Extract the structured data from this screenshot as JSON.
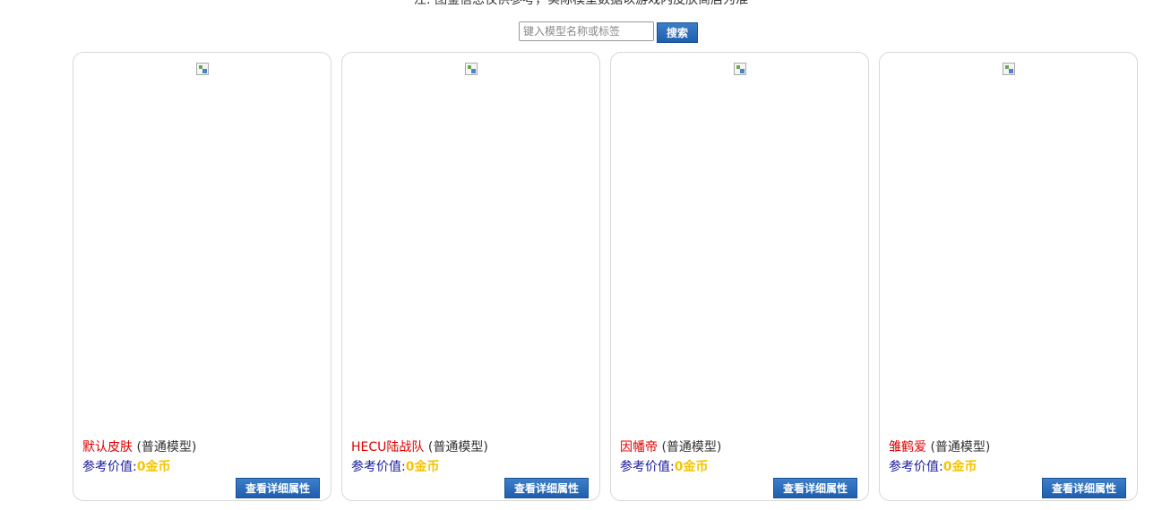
{
  "notice": "注: 图鉴信息仅供参考，实际模型数据以游戏内皮肤商店为准",
  "search": {
    "placeholder": "键入模型名称或标签",
    "button_label": "搜索"
  },
  "cards": [
    {
      "name": "默认皮肤",
      "type": "(普通模型)",
      "price_label": "参考价值:",
      "price_value": "0金币",
      "detail_label": "查看详细属性"
    },
    {
      "name": "HECU陆战队",
      "type": "(普通模型)",
      "price_label": "参考价值:",
      "price_value": "0金币",
      "detail_label": "查看详细属性"
    },
    {
      "name": "因幡帝",
      "type": "(普通模型)",
      "price_label": "参考价值:",
      "price_value": "0金币",
      "detail_label": "查看详细属性"
    },
    {
      "name": "雏鹤爱",
      "type": "(普通模型)",
      "price_label": "参考价值:",
      "price_value": "0金币",
      "detail_label": "查看详细属性"
    }
  ]
}
